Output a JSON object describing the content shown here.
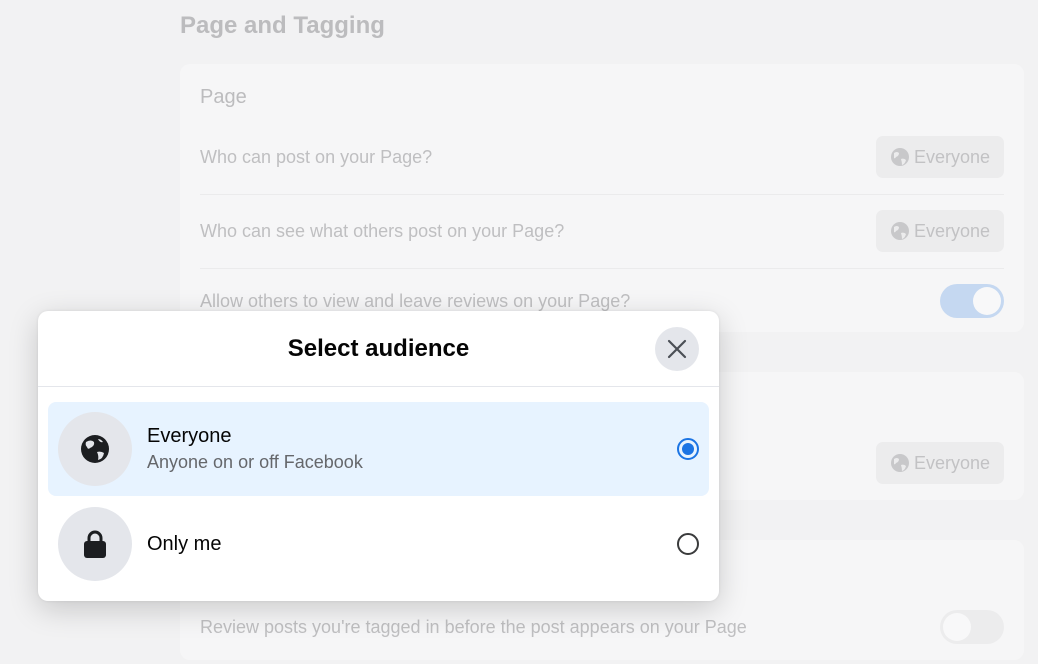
{
  "background": {
    "section_title": "Page and Tagging",
    "page_card": {
      "title": "Page",
      "rows": [
        {
          "label": "Who can post on your Page?",
          "value": "Everyone",
          "icon": "globe-icon"
        },
        {
          "label": "Who can see what others post on your Page?",
          "value": "Everyone",
          "icon": "globe-icon"
        },
        {
          "label": "Allow others to view and leave reviews on your Page?",
          "toggle": "on"
        }
      ]
    },
    "second_card": {
      "value": "Everyone",
      "icon": "globe-icon"
    },
    "tagging_card": {
      "row_label": "Review posts you're tagged in before the post appears on your Page",
      "toggle": "off"
    }
  },
  "modal": {
    "title": "Select audience",
    "close_icon": "close-icon",
    "options": [
      {
        "label": "Everyone",
        "sublabel": "Anyone on or off Facebook",
        "icon": "globe-icon",
        "selected": true
      },
      {
        "label": "Only me",
        "sublabel": "",
        "icon": "lock-icon",
        "selected": false
      }
    ]
  },
  "colors": {
    "accent": "#1b74e4",
    "selected_bg": "#e7f3ff"
  }
}
